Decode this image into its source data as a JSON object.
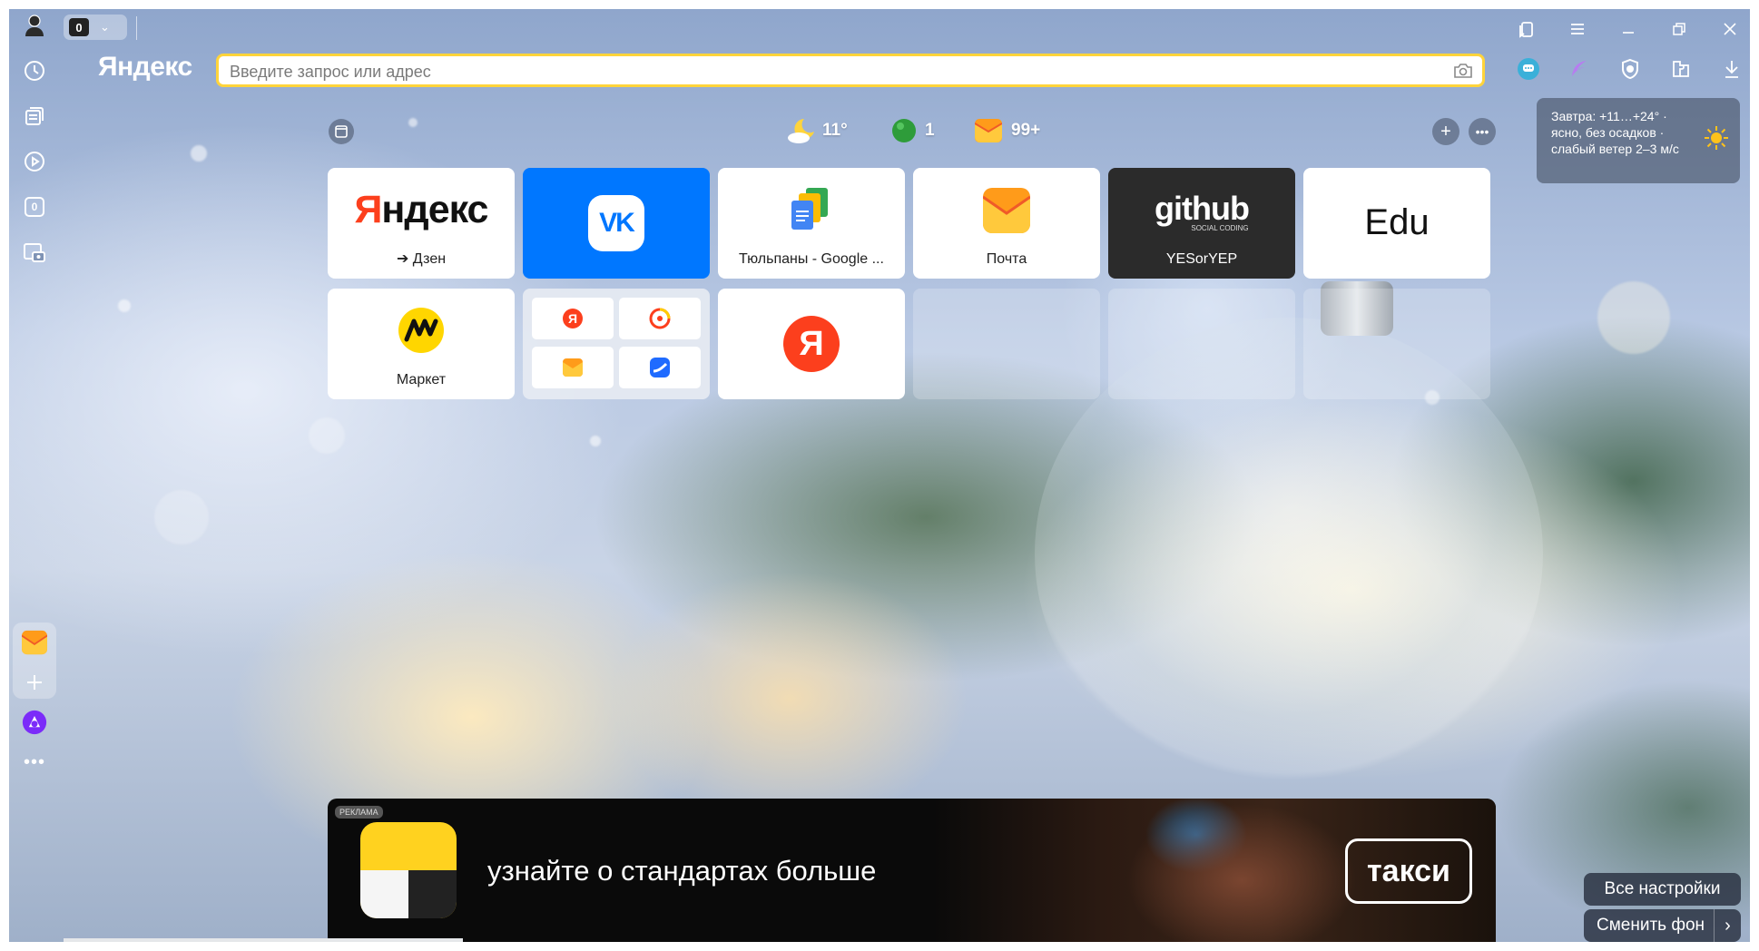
{
  "browser": {
    "brand": "Яндекс",
    "tabs_counter": "0",
    "address_placeholder": "Введите запрос или адрес"
  },
  "sidebar": {
    "tabs_counter": "0"
  },
  "infobar": {
    "weather_temp": "11°",
    "traffic_score": "1",
    "mail_count": "99+"
  },
  "weather_card": {
    "text": "Завтра: +11…+24° · ясно, без осадков · слабый ветер 2–3 м/с"
  },
  "tiles": [
    {
      "title": "Яндекс",
      "label": "➔ Дзен"
    },
    {
      "title": "VK",
      "label": ""
    },
    {
      "title": "Google Docs",
      "label": "Тюльпаны - Google ..."
    },
    {
      "title": "Почта",
      "label": "Почта"
    },
    {
      "title": "github",
      "subtitle": "SOCIAL CODING",
      "label": "YESorYEP"
    },
    {
      "title": "Edu",
      "label": ""
    },
    {
      "title": "Маркет",
      "label": "Маркет"
    },
    {
      "title": "Группа",
      "label": ""
    },
    {
      "title": "Я",
      "label": ""
    }
  ],
  "ad": {
    "badge": "РЕКЛАМА",
    "text": "узнайте о стандартах больше",
    "button": "такси"
  },
  "buttons": {
    "all_settings": "Все настройки",
    "change_bg": "Сменить фон"
  },
  "colors": {
    "omnibox_border": "#ffd43b",
    "vk_blue": "#0077ff",
    "yandex_red": "#fc3f1d"
  }
}
